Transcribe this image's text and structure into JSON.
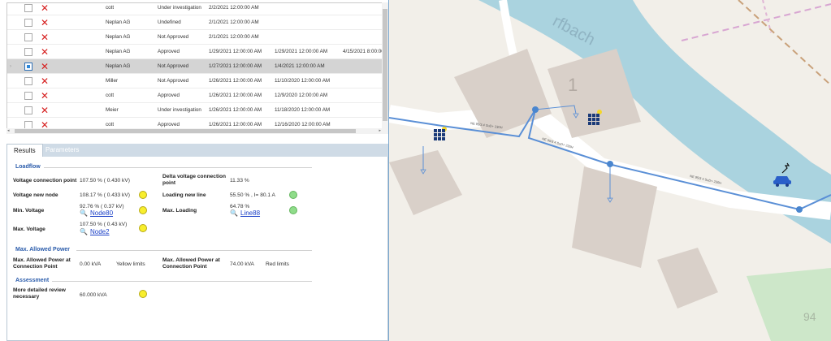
{
  "grid": {
    "rows": [
      {
        "name": "cott",
        "status": "Under investigation",
        "d1": "2/2/2021 12:00:00 AM",
        "d2": "",
        "d3": "",
        "selected": false
      },
      {
        "name": "Neplan AG",
        "status": "Undefined",
        "d1": "2/1/2021 12:00:00 AM",
        "d2": "",
        "d3": "",
        "selected": false
      },
      {
        "name": "Neplan AG",
        "status": "Not Approved",
        "d1": "2/1/2021 12:00:00 AM",
        "d2": "",
        "d3": "",
        "selected": false
      },
      {
        "name": "Neplan AG",
        "status": "Approved",
        "d1": "1/29/2021 12:00:00 AM",
        "d2": "1/29/2021 12:00:00 AM",
        "d3": "4/15/2021 8:00:00",
        "selected": false
      },
      {
        "name": "Neplan AG",
        "status": "Not Approved",
        "d1": "1/27/2021 12:00:00 AM",
        "d2": "1/4/2021 12:00:00 AM",
        "d3": "",
        "selected": true
      },
      {
        "name": "Miller",
        "status": "Not Approved",
        "d1": "1/26/2021 12:00:00 AM",
        "d2": "11/10/2020 12:00:00 AM",
        "d3": "",
        "selected": false
      },
      {
        "name": "cott",
        "status": "Approved",
        "d1": "1/26/2021 12:00:00 AM",
        "d2": "12/9/2020 12:00:00 AM",
        "d3": "",
        "selected": false
      },
      {
        "name": "Meier",
        "status": "Under investigation",
        "d1": "1/26/2021 12:00:00 AM",
        "d2": "11/18/2020 12:00:00 AM",
        "d3": "",
        "selected": false
      },
      {
        "name": "cott",
        "status": "Approved",
        "d1": "1/26/2021 12:00:00 AM",
        "d2": "12/16/2020 12:00:00 AM",
        "d3": "",
        "selected": false
      }
    ]
  },
  "tabs": {
    "results": "Results",
    "parameters": "Parameters"
  },
  "loadflow": {
    "title": "Loadflow",
    "voltage_connection_point_label": "Voltage connection point",
    "voltage_connection_point_value": "107.50 % ( 0.430  kV)",
    "delta_voltage_label": "Delta voltage connection point",
    "delta_voltage_value": "11.33 %",
    "voltage_new_node_label": "Voltage new node",
    "voltage_new_node_value": "108.17 % ( 0.433  kV)",
    "loading_new_line_label": "Loading new line",
    "loading_new_line_value": "55.50 % , I= 80.1 A",
    "min_voltage_label": "Min. Voltage",
    "min_voltage_value": "92.76 % ( 0.37  kV)",
    "min_voltage_node": "Node80",
    "max_loading_label": "Max. Loading",
    "max_loading_value": "64.78 %",
    "max_loading_line": "Line88",
    "max_voltage_label": "Max. Voltage",
    "max_voltage_value": "107.50 % ( 0.43  kV)",
    "max_voltage_node": "Node2"
  },
  "max_power": {
    "title": "Max. Allowed Power",
    "left_label": "Max. Allowed Power at Connection Point",
    "left_value": "0.00 kVA",
    "left_limit": "Yellow limits",
    "right_label": "Max. Allowed Power at Connection Point",
    "right_value": "74.00 kVA",
    "right_limit": "Red limits"
  },
  "assessment": {
    "title": "Assessment",
    "label": "More detailed review necessary",
    "value": "60.000 kVA"
  },
  "map": {
    "street_label": "rfbach",
    "building_number": "1",
    "corner_number": "94",
    "line_labels": [
      "NE 95/3 4 SuD+ 230H",
      "NE 95/3 4 SuD+ 230H",
      "NE 95/3 4 SuD+ 230H"
    ],
    "colors": {
      "line": "#5a8fd6",
      "node": "#4a86cf",
      "pv": "#1b3a78",
      "ev": "#2a5fc9",
      "sun": "#f4d629"
    }
  }
}
